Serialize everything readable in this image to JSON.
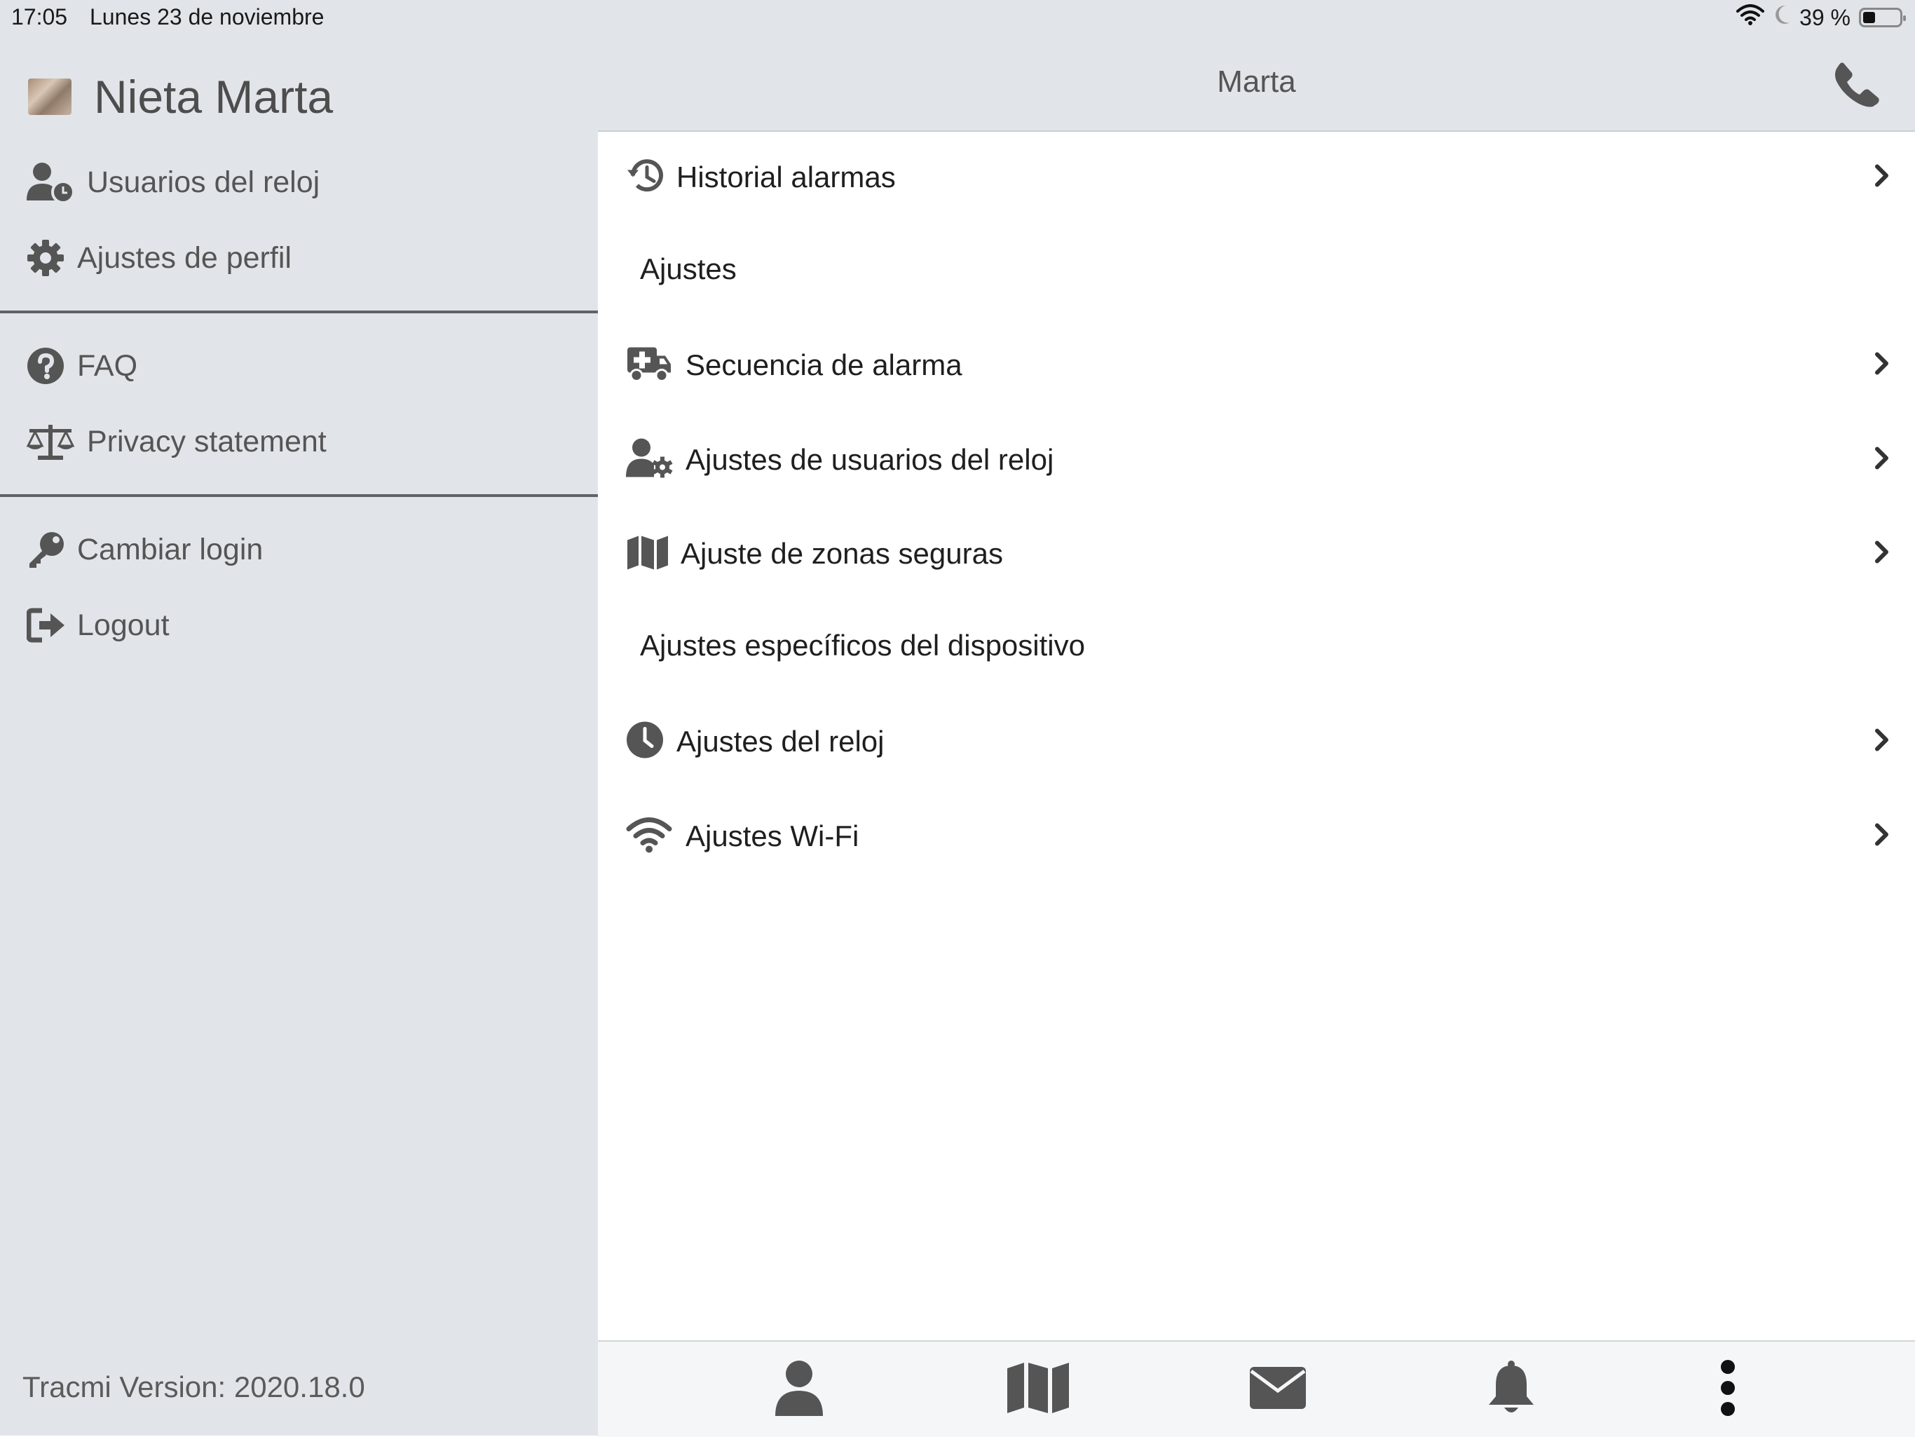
{
  "status_bar": {
    "time": "17:05",
    "date": "Lunes 23 de noviembre",
    "battery": "39 %",
    "battery_level": 0.39
  },
  "sidebar": {
    "profile_name": "Nieta Marta",
    "items": [
      {
        "label": "Usuarios del reloj",
        "icon": "user-clock-icon"
      },
      {
        "label": "Ajustes de perfil",
        "icon": "gear-icon"
      },
      {
        "label": "FAQ",
        "icon": "question-circle-icon"
      },
      {
        "label": "Privacy statement",
        "icon": "balance-scale-icon"
      },
      {
        "label": "Cambiar login",
        "icon": "key-icon"
      },
      {
        "label": "Logout",
        "icon": "sign-out-icon"
      }
    ],
    "version": "Tracmi Version: 2020.18.0"
  },
  "header": {
    "title": "Marta"
  },
  "main": {
    "history": {
      "label": "Historial alarmas",
      "icon": "history-icon"
    },
    "section_settings": "Ajustes",
    "settings": [
      {
        "label": "Secuencia de alarma",
        "icon": "ambulance-icon"
      },
      {
        "label": "Ajustes de usuarios del reloj",
        "icon": "user-gear-icon"
      },
      {
        "label": "Ajuste de zonas seguras",
        "icon": "map-icon"
      }
    ],
    "section_device": "Ajustes específicos del dispositivo",
    "device": [
      {
        "label": "Ajustes del reloj",
        "icon": "clock-icon"
      },
      {
        "label": "Ajustes Wi-Fi",
        "icon": "wifi-icon"
      }
    ]
  },
  "tabbar": {
    "tabs": [
      "user-icon",
      "map-icon",
      "envelope-icon",
      "bell-icon",
      "more-vertical-icon"
    ]
  }
}
